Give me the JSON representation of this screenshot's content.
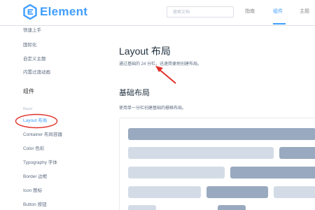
{
  "header": {
    "logo_text": "Element",
    "search_placeholder": "搜索文档",
    "nav": [
      "指南",
      "组件",
      "主题"
    ],
    "active_nav": "组件"
  },
  "sidebar": {
    "items_top": [
      "快速上手",
      "国际化",
      "自定义主题",
      "内置过渡动画"
    ],
    "group_title": "组件",
    "sub_group": "Basic",
    "components": [
      "Layout 布局",
      "Container 布局容器",
      "Color 色彩",
      "Typography 字体",
      "Border 边框",
      "Icon 图标",
      "Button 按钮"
    ],
    "active_item": "Layout 布局"
  },
  "main": {
    "title": "Layout 布局",
    "description": "通过基础的 24 分栏，迅速简便地创建布局。",
    "section_title": "基础布局",
    "section_description": "使用单一分栏创建基础的栅格布局。"
  },
  "colors": {
    "accent": "#409eff",
    "annotation": "#e0312a",
    "bar_dark": "#99a9bf",
    "bar_light": "#d3dce6"
  },
  "icons": [
    "element-logo-icon"
  ]
}
